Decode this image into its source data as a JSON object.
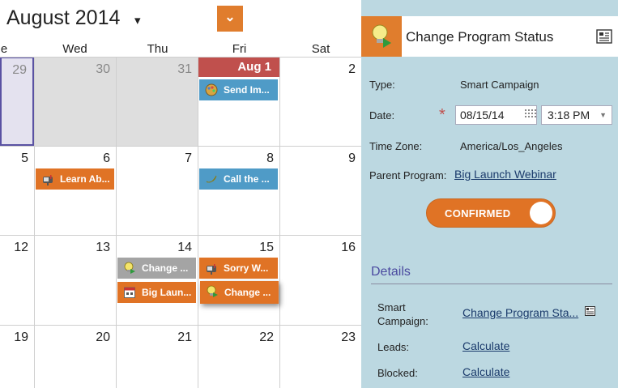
{
  "calendar": {
    "month_title": "August 2014",
    "title_caret": "▾",
    "dropdown_caret": "⌄",
    "weekdays": [
      {
        "label": "e"
      },
      {
        "label": "Wed"
      },
      {
        "label": "Thu"
      },
      {
        "label": "Fri"
      },
      {
        "label": "Sat"
      }
    ],
    "days": {
      "r1": [
        "29",
        "30",
        "31",
        "Aug 1",
        "2"
      ],
      "r2": [
        "5",
        "6",
        "7",
        "8",
        "9"
      ],
      "r3": [
        "12",
        "13",
        "14",
        "15",
        "16"
      ],
      "r4": [
        "19",
        "20",
        "21",
        "22",
        "23"
      ]
    },
    "events": {
      "send_im": "Send Im...",
      "learn_ab": "Learn Ab...",
      "call_the": "Call the ...",
      "change_grey": "Change ...",
      "sorry_w": "Sorry W...",
      "big_laun": "Big Laun...",
      "change_orange": "Change ..."
    },
    "colors": {
      "event_blue": "#4f9bc7",
      "event_orange": "#e07325",
      "event_grey": "#a4a4a4",
      "today_red": "#c0504d"
    }
  },
  "panel": {
    "title": "Change Program Status",
    "type_label": "Type:",
    "type_value": "Smart Campaign",
    "date_label": "Date:",
    "required_mark": "*",
    "date_value": "08/15/14",
    "time_value": "3:18 PM",
    "time_caret": "▼",
    "timezone_label": "Time Zone:",
    "timezone_value": "America/Los_Angeles",
    "parent_label": "Parent Program:",
    "parent_value": "Big Launch Webinar",
    "toggle_label": "CONFIRMED",
    "details_title": "Details",
    "smart_campaign_label_1": "Smart",
    "smart_campaign_label_2": "Campaign:",
    "smart_campaign_value": "Change Program Sta...",
    "leads_label": "Leads:",
    "leads_value": "Calculate",
    "blocked_label": "Blocked:",
    "blocked_value": "Calculate",
    "colors": {
      "panel_bg": "#bcd8e1",
      "accent_orange": "#e07d2d",
      "section_purple": "#4b4aa0"
    }
  }
}
